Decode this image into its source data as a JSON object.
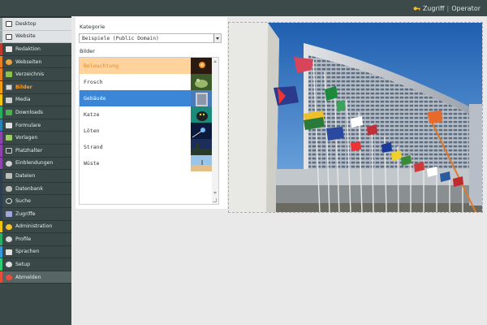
{
  "header": {
    "access_label": "Zugriff",
    "separator": "|",
    "user": "Operator",
    "key_icon": "key-icon"
  },
  "sidebar": {
    "items": [
      {
        "label": "Desktop",
        "icon": "desktop-icon",
        "color": "#cfd6d6"
      },
      {
        "label": "Website",
        "icon": "website-icon",
        "color": "#cfd6d6"
      },
      {
        "label": "Redaktion",
        "icon": "edit-icon",
        "color": "#c0392b"
      },
      {
        "label": "Webseiten",
        "icon": "pages-icon",
        "color": "#e67e22"
      },
      {
        "label": "Verzeichnis",
        "icon": "sitemap-icon",
        "color": "#e67e22"
      },
      {
        "label": "Bilder",
        "icon": "images-icon",
        "color": "#f39c12"
      },
      {
        "label": "Media",
        "icon": "media-icon",
        "color": "#f1c40f"
      },
      {
        "label": "Downloads",
        "icon": "download-icon",
        "color": "#27ae60"
      },
      {
        "label": "Formulare",
        "icon": "forms-icon",
        "color": "#2980b9"
      },
      {
        "label": "Vorlagen",
        "icon": "templates-icon",
        "color": "#8e44ad"
      },
      {
        "label": "Platzhalter",
        "icon": "placeholder-icon",
        "color": "#8e44ad"
      },
      {
        "label": "Einblendungen",
        "icon": "overlay-icon",
        "color": "#8e44ad"
      },
      {
        "label": "Dateien",
        "icon": "files-icon",
        "color": "#2c3e50"
      },
      {
        "label": "Datenbank",
        "icon": "database-icon",
        "color": "#2c3e50"
      },
      {
        "label": "Suche",
        "icon": "search-icon",
        "color": "#2c3e50"
      },
      {
        "label": "Zugriffe",
        "icon": "stats-icon",
        "color": "#2c3e50"
      },
      {
        "label": "Administration",
        "icon": "key-icon",
        "color": "#f1c40f"
      },
      {
        "label": "Profile",
        "icon": "profile-icon",
        "color": "#27ae60"
      },
      {
        "label": "Sprachen",
        "icon": "language-icon",
        "color": "#3498db"
      },
      {
        "label": "Setup",
        "icon": "gear-icon",
        "color": "#2ecc71"
      },
      {
        "label": "Abmelden",
        "icon": "logout-icon",
        "color": "#e74c3c"
      }
    ]
  },
  "form": {
    "category_label": "Kategorie",
    "category_value": "Beispiele (Public Domain)",
    "images_label": "Bilder"
  },
  "images": {
    "items": [
      {
        "label": "Beleuchtung",
        "state": "hover"
      },
      {
        "label": "Frosch",
        "state": "normal"
      },
      {
        "label": "Gebäude",
        "state": "selected"
      },
      {
        "label": "Katze",
        "state": "normal"
      },
      {
        "label": "Löten",
        "state": "normal"
      },
      {
        "label": "Strand",
        "state": "normal"
      },
      {
        "label": "Wüste",
        "state": "normal"
      }
    ]
  },
  "colors": {
    "accent_orange": "#ff9b28",
    "selection_blue": "#3b86d7",
    "sidebar_bg": "#3a4848"
  }
}
